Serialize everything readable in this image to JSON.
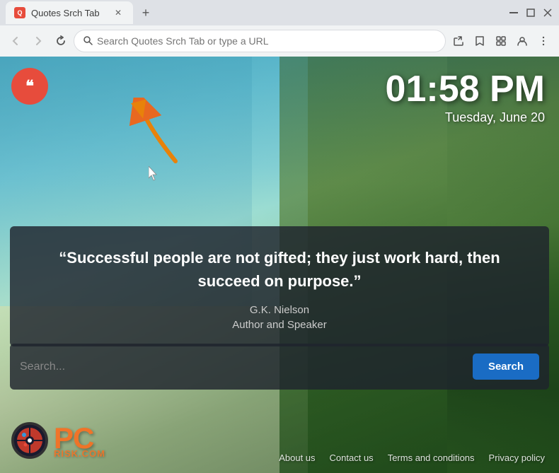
{
  "browser": {
    "tab_title": "Quotes Srch Tab",
    "new_tab_symbol": "+",
    "address": "Search Quotes Srch Tab or type a URL",
    "window_minimize": "—",
    "window_maximize": "□",
    "window_close": "✕"
  },
  "page": {
    "clock": {
      "time": "01:58 PM",
      "date": "Tuesday, June 20"
    },
    "quote": {
      "text": "“Successful people are not gifted; they just work hard, then succeed on purpose.”",
      "author": "G.K. Nielson",
      "role": "Author and Speaker"
    },
    "search": {
      "placeholder": "Search...",
      "button_label": "Search"
    },
    "footer": {
      "links": [
        {
          "label": "About us"
        },
        {
          "label": "Contact us"
        },
        {
          "label": "Terms and conditions"
        },
        {
          "label": "Privacy policy"
        }
      ]
    },
    "logo_text": "PC",
    "logo_subtext": "RISK.COM"
  }
}
